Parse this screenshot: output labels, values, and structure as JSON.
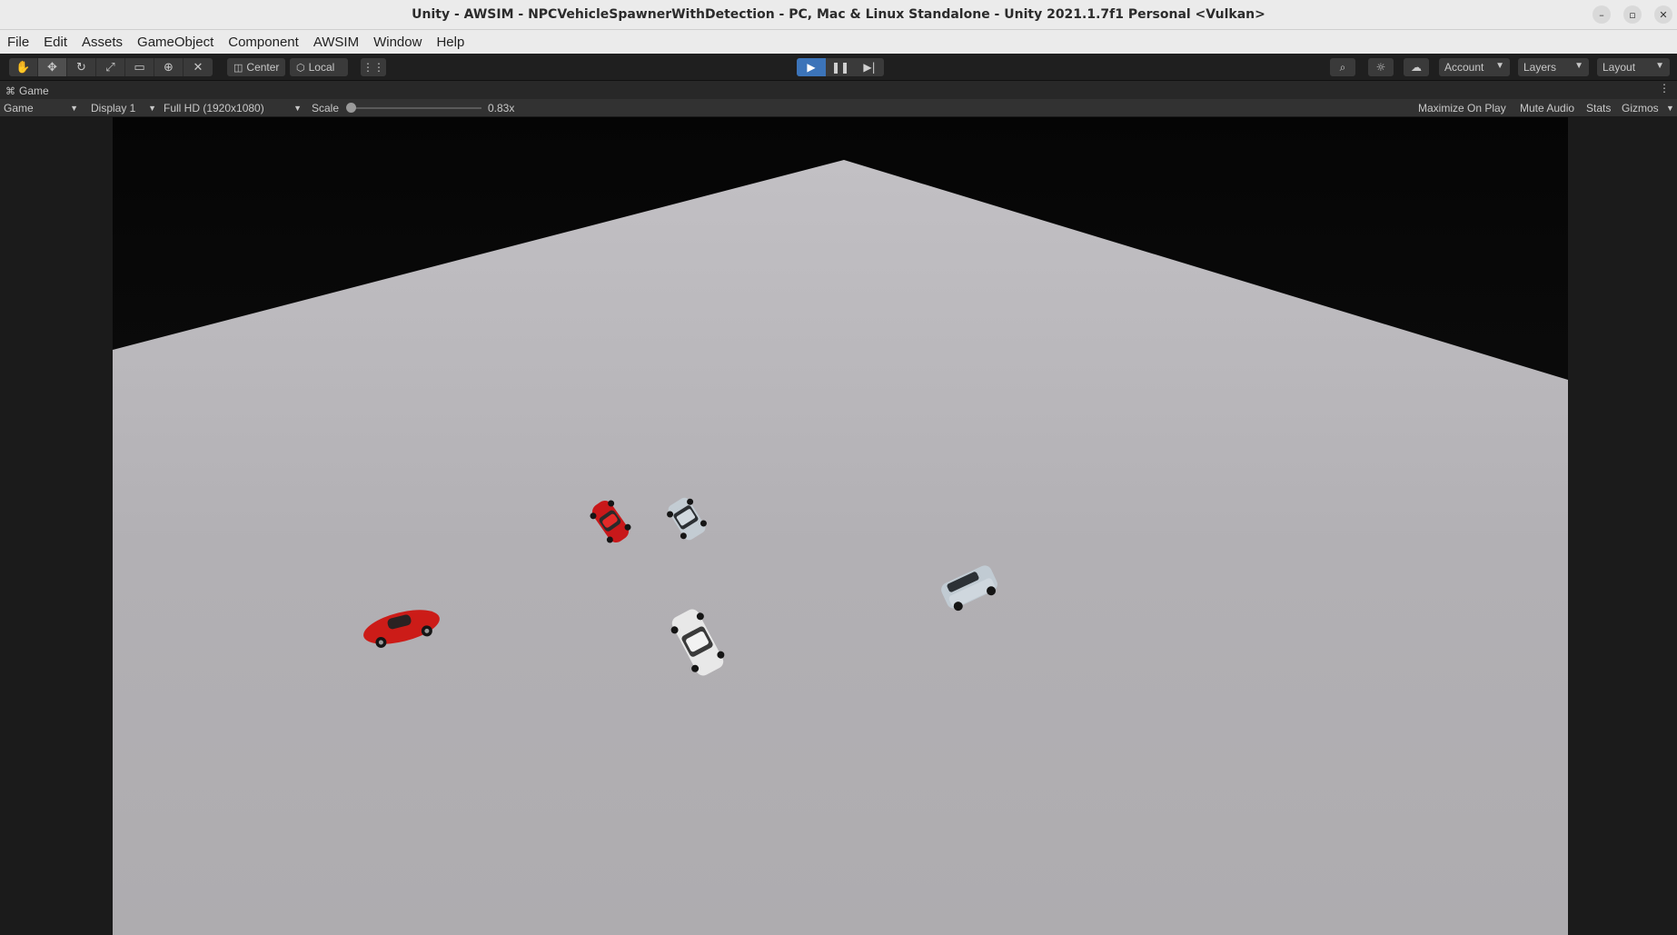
{
  "window": {
    "title": "Unity - AWSIM - NPCVehicleSpawnerWithDetection - PC, Mac & Linux Standalone - Unity 2021.1.7f1 Personal <Vulkan>"
  },
  "menu": [
    "File",
    "Edit",
    "Assets",
    "GameObject",
    "Component",
    "AWSIM",
    "Window",
    "Help"
  ],
  "toolbar": {
    "tools": [
      "hand-icon",
      "move-icon",
      "rotate-icon",
      "scale-icon",
      "rect-icon",
      "transform-icon",
      "custom-tool-icon"
    ],
    "pivot_label": "Center",
    "space_label": "Local",
    "account_label": "Account",
    "layers_label": "Layers",
    "layout_label": "Layout"
  },
  "tab": {
    "label": "Game"
  },
  "game_bar": {
    "view_mode": "Game",
    "display": "Display 1",
    "resolution": "Full HD (1920x1080)",
    "scale_label": "Scale",
    "scale_value": "0.83x",
    "maximize": "Maximize On Play",
    "mute": "Mute Audio",
    "stats": "Stats",
    "gizmos": "Gizmos"
  },
  "colors": {
    "ground": "#b3b1b4",
    "sky": "#0f0f0f",
    "play_active": "#3c74b9",
    "car_red": "#d01a17",
    "car_white": "#e6e6e6",
    "car_gray": "#c4cdd4"
  }
}
